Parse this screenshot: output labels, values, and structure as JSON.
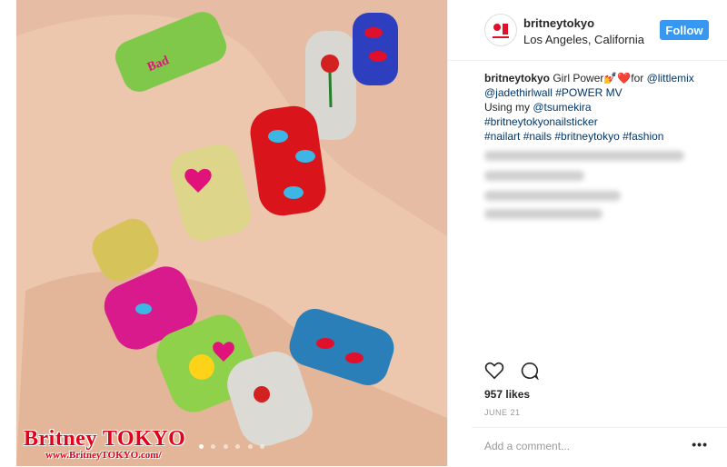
{
  "post": {
    "username": "britneytokyo",
    "location": "Los Angeles, California",
    "follow_label": "Follow",
    "caption_username": "britneytokyo",
    "caption_line1_text": " Girl Power",
    "caption_line1_emoji": "💅❤️",
    "caption_line1_suffix": "for ",
    "mention_littlemix": "@littlemix",
    "mention_jade": "@jadethirlwall",
    "hashtag_power": " #POWER MV",
    "using_label": "Using my ",
    "mention_tsumekira": "@tsumekira",
    "hashtag_sticker": "#britneytokyonailsticker",
    "hashtags_line": "#nailart #nails #britneytokyo #fashion",
    "likes": "957 likes",
    "date": "JUNE 21",
    "comment_placeholder": "Add a comment...",
    "more_label": "•••"
  },
  "icons": {
    "heart": "heart-icon",
    "comment": "comment-icon",
    "avatar": "avatar"
  },
  "watermark": {
    "brand_left": "Britney",
    "brand_right": "TOKYO",
    "url": "www.BritneyTOKYO.com/"
  },
  "carousel": {
    "count": 6,
    "active_index": 0
  },
  "colors": {
    "follow_bg": "#3897f0",
    "watermark": "#e2001a",
    "link": "#003569"
  }
}
